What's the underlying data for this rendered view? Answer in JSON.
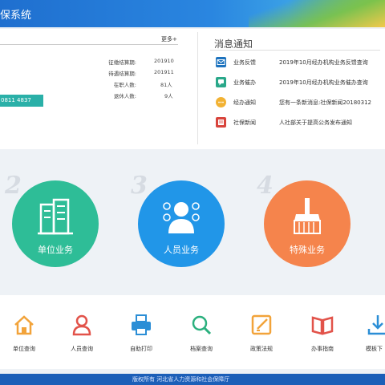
{
  "header": {
    "title": "保系统"
  },
  "panel": {
    "more_label": "更多+",
    "stats": [
      {
        "label": "征缴结算期:",
        "value": "201910"
      },
      {
        "label": "待遇结算期:",
        "value": "201911"
      },
      {
        "label": "在职人数:",
        "value": "81人"
      },
      {
        "label": "退休人数:",
        "value": "9人"
      }
    ],
    "account": "0811 4837"
  },
  "messages": {
    "title": "消息通知",
    "items": [
      {
        "type": "业务反馈",
        "text": "2019年10月经办机构业务反馈查询",
        "icon": "mail-icon",
        "color": "#1e73be"
      },
      {
        "type": "业务催办",
        "text": "2019年10月经办机构业务催办查询",
        "icon": "chat-icon",
        "color": "#2aa88a"
      },
      {
        "type": "经办通知",
        "text": "您有一条新消息:社保新闻20180312",
        "icon": "bubble-icon",
        "color": "#f2b233"
      },
      {
        "type": "社保新闻",
        "text": "人社部关于提高公务发布通知",
        "icon": "news-icon",
        "color": "#d8443c"
      }
    ]
  },
  "categories": [
    {
      "num": "2",
      "label": "单位业务",
      "color": "#2ebd97",
      "icon": "building-icon"
    },
    {
      "num": "3",
      "label": "人员业务",
      "color": "#2196e8",
      "icon": "person-icon"
    },
    {
      "num": "4",
      "label": "特殊业务",
      "color": "#f5844c",
      "icon": "broom-icon"
    }
  ],
  "quick": [
    {
      "label": "单位查询",
      "icon": "home-icon",
      "color": "#f2a33a"
    },
    {
      "label": "人员查询",
      "icon": "user-icon",
      "color": "#e2534a"
    },
    {
      "label": "自助打印",
      "icon": "printer-icon",
      "color": "#2b8ed6"
    },
    {
      "label": "档案查询",
      "icon": "magnifier-icon",
      "color": "#2bb07e"
    },
    {
      "label": "政策法规",
      "icon": "edit-icon",
      "color": "#f2a33a"
    },
    {
      "label": "办事指南",
      "icon": "book-icon",
      "color": "#e2534a"
    },
    {
      "label": "模板下",
      "icon": "download-icon",
      "color": "#2b8ed6"
    }
  ],
  "footer": {
    "text": "版权所有 河北省人力资源和社会保障厅"
  }
}
